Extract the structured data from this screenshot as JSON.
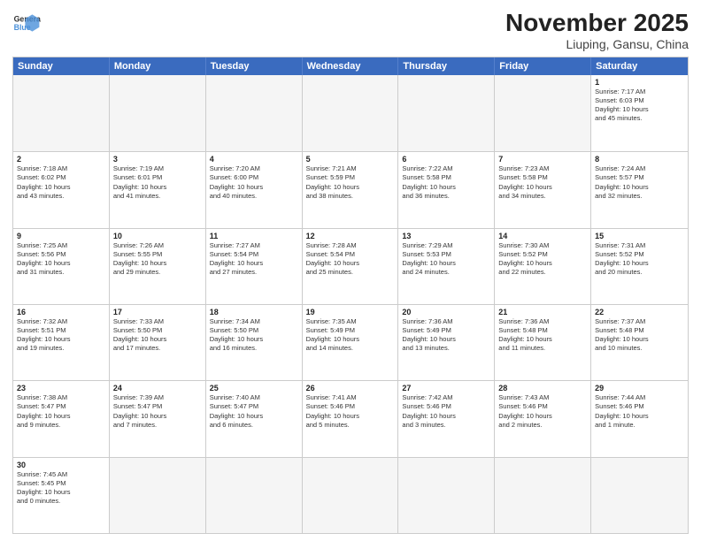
{
  "header": {
    "logo_general": "General",
    "logo_blue": "Blue",
    "month_title": "November 2025",
    "location": "Liuping, Gansu, China"
  },
  "weekdays": [
    "Sunday",
    "Monday",
    "Tuesday",
    "Wednesday",
    "Thursday",
    "Friday",
    "Saturday"
  ],
  "weeks": [
    [
      {
        "day": "",
        "info": ""
      },
      {
        "day": "",
        "info": ""
      },
      {
        "day": "",
        "info": ""
      },
      {
        "day": "",
        "info": ""
      },
      {
        "day": "",
        "info": ""
      },
      {
        "day": "",
        "info": ""
      },
      {
        "day": "1",
        "info": "Sunrise: 7:17 AM\nSunset: 6:03 PM\nDaylight: 10 hours\nand 45 minutes."
      }
    ],
    [
      {
        "day": "2",
        "info": "Sunrise: 7:18 AM\nSunset: 6:02 PM\nDaylight: 10 hours\nand 43 minutes."
      },
      {
        "day": "3",
        "info": "Sunrise: 7:19 AM\nSunset: 6:01 PM\nDaylight: 10 hours\nand 41 minutes."
      },
      {
        "day": "4",
        "info": "Sunrise: 7:20 AM\nSunset: 6:00 PM\nDaylight: 10 hours\nand 40 minutes."
      },
      {
        "day": "5",
        "info": "Sunrise: 7:21 AM\nSunset: 5:59 PM\nDaylight: 10 hours\nand 38 minutes."
      },
      {
        "day": "6",
        "info": "Sunrise: 7:22 AM\nSunset: 5:58 PM\nDaylight: 10 hours\nand 36 minutes."
      },
      {
        "day": "7",
        "info": "Sunrise: 7:23 AM\nSunset: 5:58 PM\nDaylight: 10 hours\nand 34 minutes."
      },
      {
        "day": "8",
        "info": "Sunrise: 7:24 AM\nSunset: 5:57 PM\nDaylight: 10 hours\nand 32 minutes."
      }
    ],
    [
      {
        "day": "9",
        "info": "Sunrise: 7:25 AM\nSunset: 5:56 PM\nDaylight: 10 hours\nand 31 minutes."
      },
      {
        "day": "10",
        "info": "Sunrise: 7:26 AM\nSunset: 5:55 PM\nDaylight: 10 hours\nand 29 minutes."
      },
      {
        "day": "11",
        "info": "Sunrise: 7:27 AM\nSunset: 5:54 PM\nDaylight: 10 hours\nand 27 minutes."
      },
      {
        "day": "12",
        "info": "Sunrise: 7:28 AM\nSunset: 5:54 PM\nDaylight: 10 hours\nand 25 minutes."
      },
      {
        "day": "13",
        "info": "Sunrise: 7:29 AM\nSunset: 5:53 PM\nDaylight: 10 hours\nand 24 minutes."
      },
      {
        "day": "14",
        "info": "Sunrise: 7:30 AM\nSunset: 5:52 PM\nDaylight: 10 hours\nand 22 minutes."
      },
      {
        "day": "15",
        "info": "Sunrise: 7:31 AM\nSunset: 5:52 PM\nDaylight: 10 hours\nand 20 minutes."
      }
    ],
    [
      {
        "day": "16",
        "info": "Sunrise: 7:32 AM\nSunset: 5:51 PM\nDaylight: 10 hours\nand 19 minutes."
      },
      {
        "day": "17",
        "info": "Sunrise: 7:33 AM\nSunset: 5:50 PM\nDaylight: 10 hours\nand 17 minutes."
      },
      {
        "day": "18",
        "info": "Sunrise: 7:34 AM\nSunset: 5:50 PM\nDaylight: 10 hours\nand 16 minutes."
      },
      {
        "day": "19",
        "info": "Sunrise: 7:35 AM\nSunset: 5:49 PM\nDaylight: 10 hours\nand 14 minutes."
      },
      {
        "day": "20",
        "info": "Sunrise: 7:36 AM\nSunset: 5:49 PM\nDaylight: 10 hours\nand 13 minutes."
      },
      {
        "day": "21",
        "info": "Sunrise: 7:36 AM\nSunset: 5:48 PM\nDaylight: 10 hours\nand 11 minutes."
      },
      {
        "day": "22",
        "info": "Sunrise: 7:37 AM\nSunset: 5:48 PM\nDaylight: 10 hours\nand 10 minutes."
      }
    ],
    [
      {
        "day": "23",
        "info": "Sunrise: 7:38 AM\nSunset: 5:47 PM\nDaylight: 10 hours\nand 9 minutes."
      },
      {
        "day": "24",
        "info": "Sunrise: 7:39 AM\nSunset: 5:47 PM\nDaylight: 10 hours\nand 7 minutes."
      },
      {
        "day": "25",
        "info": "Sunrise: 7:40 AM\nSunset: 5:47 PM\nDaylight: 10 hours\nand 6 minutes."
      },
      {
        "day": "26",
        "info": "Sunrise: 7:41 AM\nSunset: 5:46 PM\nDaylight: 10 hours\nand 5 minutes."
      },
      {
        "day": "27",
        "info": "Sunrise: 7:42 AM\nSunset: 5:46 PM\nDaylight: 10 hours\nand 3 minutes."
      },
      {
        "day": "28",
        "info": "Sunrise: 7:43 AM\nSunset: 5:46 PM\nDaylight: 10 hours\nand 2 minutes."
      },
      {
        "day": "29",
        "info": "Sunrise: 7:44 AM\nSunset: 5:46 PM\nDaylight: 10 hours\nand 1 minute."
      }
    ],
    [
      {
        "day": "30",
        "info": "Sunrise: 7:45 AM\nSunset: 5:45 PM\nDaylight: 10 hours\nand 0 minutes."
      },
      {
        "day": "",
        "info": ""
      },
      {
        "day": "",
        "info": ""
      },
      {
        "day": "",
        "info": ""
      },
      {
        "day": "",
        "info": ""
      },
      {
        "day": "",
        "info": ""
      },
      {
        "day": "",
        "info": ""
      }
    ]
  ]
}
